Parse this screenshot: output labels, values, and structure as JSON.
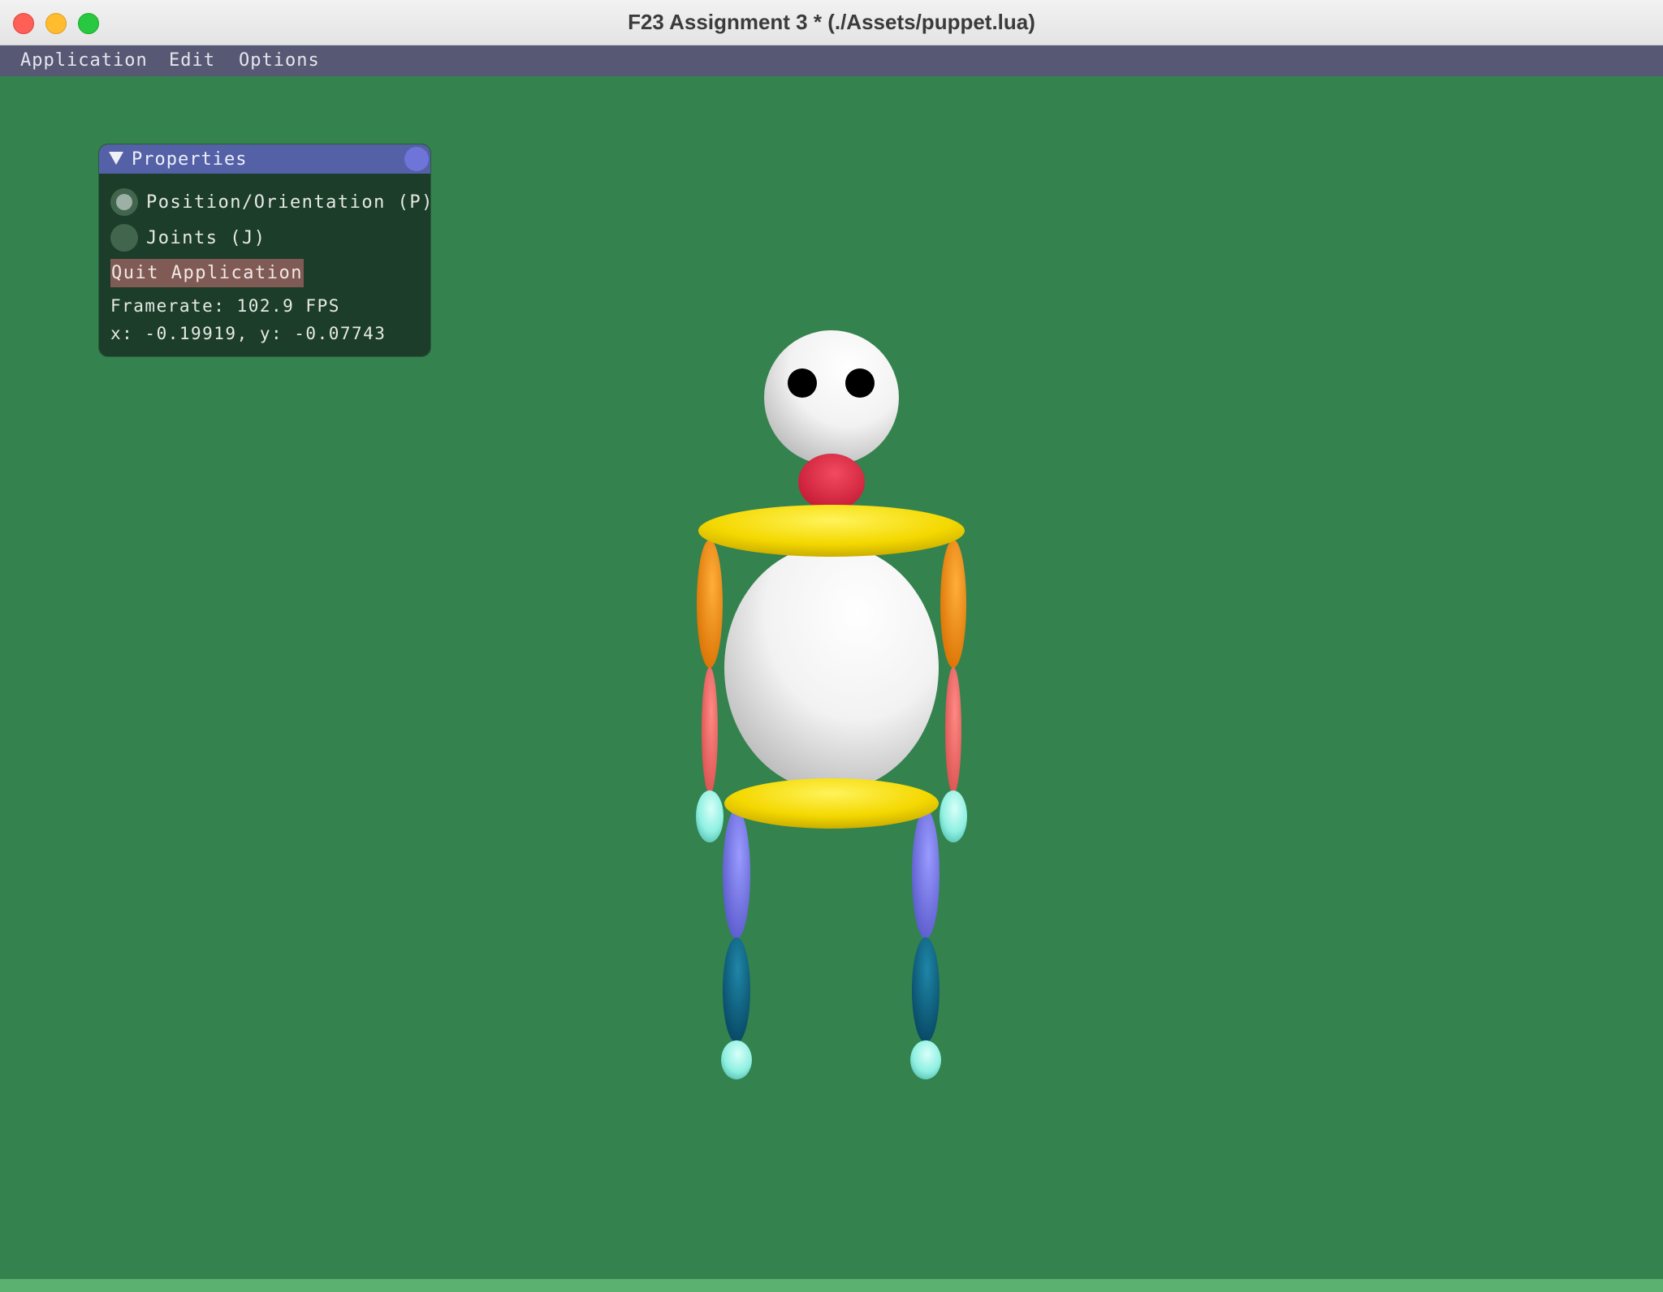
{
  "window": {
    "title": "F23 Assignment 3 * (./Assets/puppet.lua)"
  },
  "menubar": {
    "items": [
      "Application",
      "Edit",
      "Options"
    ]
  },
  "properties_panel": {
    "title": "Properties",
    "modes": [
      {
        "label": "Position/Orientation (P)",
        "selected": true
      },
      {
        "label": "Joints (J)",
        "selected": false
      }
    ],
    "quit_label": "Quit Application",
    "framerate": "Framerate: 102.9 FPS",
    "coords": "x: -0.19919, y: -0.07743"
  },
  "colors": {
    "background": "#34824e",
    "head": "#ffffff",
    "neck": "#e02040",
    "shoulders": "#f2d400",
    "upper_arm": "#f0880a",
    "forearm": "#ee6060",
    "hand": "#8ff0e2",
    "thigh": "#6f70e8",
    "calf": "#0a5f80",
    "foot": "#8ff0e2"
  }
}
